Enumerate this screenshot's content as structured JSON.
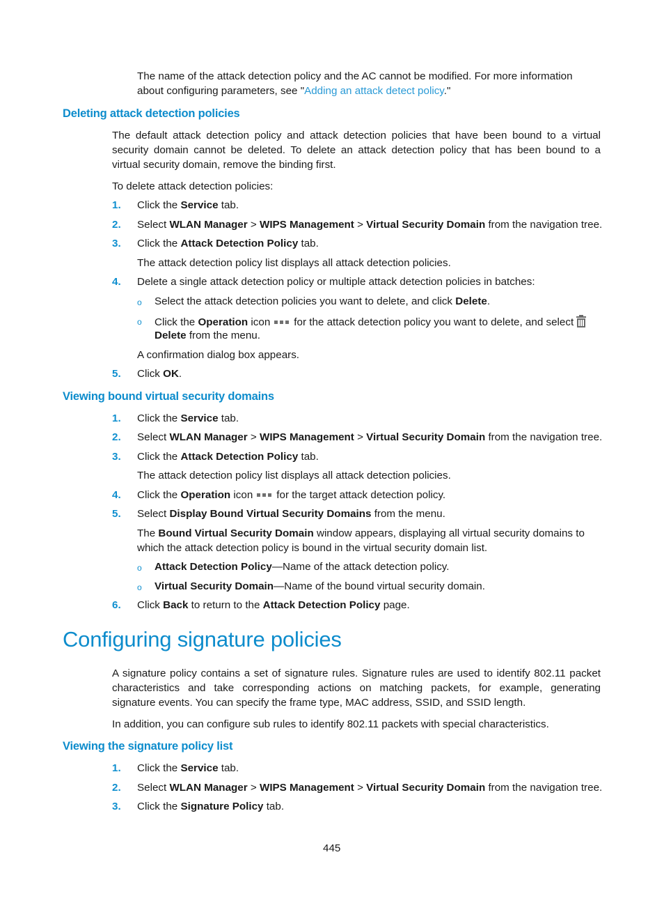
{
  "intro": {
    "line1": "The name of the attack detection policy and the AC cannot be modified. For more information",
    "line2_pre": "about configuring parameters, see \"",
    "line2_link": "Adding an attack detect policy",
    "line2_post": ".\""
  },
  "deleting": {
    "heading": "Deleting attack detection policies",
    "para_lines": [
      "The default attack detection policy and attack detection policies that have been bound to a virtual",
      "security domain cannot be deleted. To delete an attack detection policy that has been bound to a",
      "virtual security domain, remove the binding first."
    ],
    "lead": "To delete attack detection policies:",
    "steps": {
      "s1": {
        "num": "1.",
        "pre": "Click the ",
        "b1": "Service",
        "post": " tab."
      },
      "s2": {
        "num": "2.",
        "pre": "Select ",
        "b1": "WLAN Manager",
        "sep1": " > ",
        "b2": "WIPS Management",
        "sep2": " > ",
        "b3": "Virtual Security Domain",
        "post": " from the navigation tree."
      },
      "s3": {
        "num": "3.",
        "pre": "Click the ",
        "b1": "Attack Detection Policy",
        "post": " tab.",
        "note": "The attack detection policy list displays all attack detection policies."
      },
      "s4": {
        "num": "4.",
        "text": "Delete a single attack detection policy or multiple attack detection policies in batches:",
        "sub1": {
          "pre": "Select the attack detection policies you want to delete, and click ",
          "b1": "Delete",
          "post": "."
        },
        "sub2": {
          "pre": "Click the ",
          "b1": "Operation",
          "mid": " icon",
          "mid2": "for the attack detection policy you want to delete, and select",
          "b2": "Delete",
          "post": " from the menu."
        },
        "note": "A confirmation dialog box appears."
      },
      "s5": {
        "num": "5.",
        "pre": "Click ",
        "b1": "OK",
        "post": "."
      }
    },
    "icons": {
      "operation": "more-dots-icon",
      "delete": "trash-icon"
    }
  },
  "viewing_bound": {
    "heading": "Viewing bound virtual security domains",
    "steps": {
      "s1": {
        "num": "1.",
        "pre": "Click the ",
        "b1": "Service",
        "post": " tab."
      },
      "s2": {
        "num": "2.",
        "pre": "Select ",
        "b1": "WLAN Manager",
        "sep1": " > ",
        "b2": "WIPS Management",
        "sep2": " > ",
        "b3": "Virtual Security Domain",
        "post": " from the navigation tree."
      },
      "s3": {
        "num": "3.",
        "pre": "Click the ",
        "b1": "Attack Detection Policy",
        "post": " tab.",
        "note": "The attack detection policy list displays all attack detection policies."
      },
      "s4": {
        "num": "4.",
        "pre": "Click the ",
        "b1": "Operation",
        "mid": " icon",
        "post": "for the target attack detection policy."
      },
      "s5": {
        "num": "5.",
        "pre": "Select ",
        "b1": "Display Bound Virtual Security Domains",
        "post": " from the menu.",
        "note_pre": "The ",
        "note_b": "Bound Virtual Security Domain",
        "note_post": " window appears, displaying all virtual security domains to",
        "note_line2": "which the attack detection policy is bound in the virtual security domain list.",
        "sub1": {
          "b1": "Attack Detection Policy",
          "post": "—Name of the attack detection policy."
        },
        "sub2": {
          "b1": "Virtual Security Domain",
          "post": "—Name of the bound virtual security domain."
        }
      },
      "s6": {
        "num": "6.",
        "pre": "Click ",
        "b1": "Back",
        "mid": " to return to the ",
        "b2": "Attack Detection Policy",
        "post": " page."
      }
    }
  },
  "signature": {
    "title": "Configuring signature policies",
    "para_lines": [
      "A signature policy contains a set of signature rules. Signature rules are used to identify 802.11 packet",
      "characteristics and take corresponding actions on matching packets, for example, generating",
      "signature events. You can specify the frame type, MAC address, SSID, and SSID length."
    ],
    "para2": "In addition, you can configure sub rules to identify 802.11 packets with special characteristics.",
    "list_heading": "Viewing the signature policy list",
    "steps": {
      "s1": {
        "num": "1.",
        "pre": "Click the ",
        "b1": "Service",
        "post": " tab."
      },
      "s2": {
        "num": "2.",
        "pre": "Select ",
        "b1": "WLAN Manager",
        "sep1": " > ",
        "b2": "WIPS Management",
        "sep2": " > ",
        "b3": "Virtual Security Domain",
        "post": " from the navigation tree."
      },
      "s3": {
        "num": "3.",
        "pre": "Click the ",
        "b1": "Signature Policy",
        "post": " tab."
      }
    }
  },
  "bullet_glyph": "o",
  "page_number": "445"
}
